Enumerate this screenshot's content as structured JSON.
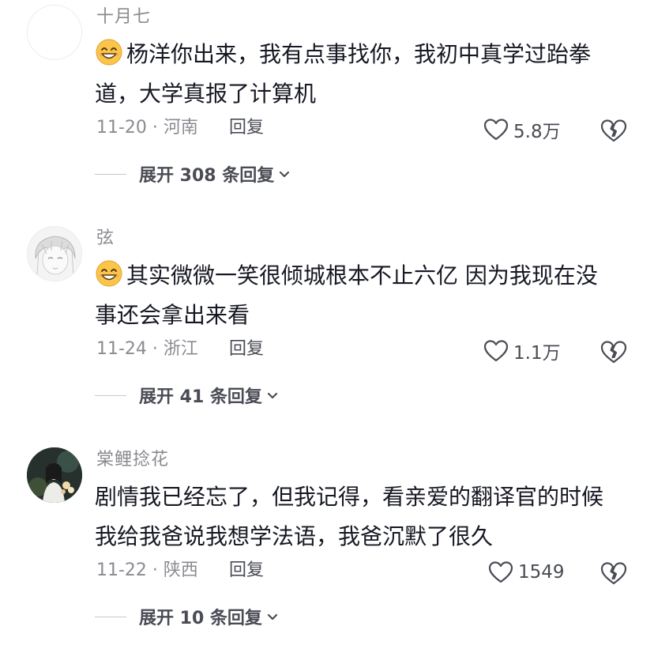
{
  "colors": {
    "primary_text": "#161823",
    "secondary_text": "#8a8b91",
    "action_text": "#4a4c55",
    "emoji_yellow": "#fbc54a"
  },
  "comments": [
    {
      "username": "十月七",
      "avatar": "blank-avatar",
      "has_emoji": true,
      "emoji": "smiling-face-icon",
      "text_line1": "杨洋你出来，我有点事找你，我初中真学过跆拳",
      "text_line2": "道，大学真报了计算机",
      "date_region": "11-20 · 河南",
      "reply_label": "回复",
      "likes": "5.8万",
      "expand_label": "展开 308 条回复"
    },
    {
      "username": "弦",
      "avatar": "sketch-avatar",
      "has_emoji": true,
      "emoji": "smiling-face-icon",
      "text_line1": "其实微微一笑很倾城根本不止六亿 因为我现在没",
      "text_line2": "事还会拿出来看",
      "date_region": "11-24 · 浙江",
      "reply_label": "回复",
      "likes": "1.1万",
      "expand_label": "展开 41 条回复"
    },
    {
      "username": "棠鲤捻花",
      "avatar": "photo-avatar",
      "has_emoji": false,
      "text_line1": "剧情我已经忘了，但我记得，看亲爱的翻译官的时候",
      "text_line2": "我给我爸说我想学法语，我爸沉默了很久",
      "date_region": "11-22 · 陕西",
      "reply_label": "回复",
      "likes": "1549",
      "expand_label": "展开 10 条回复"
    }
  ]
}
